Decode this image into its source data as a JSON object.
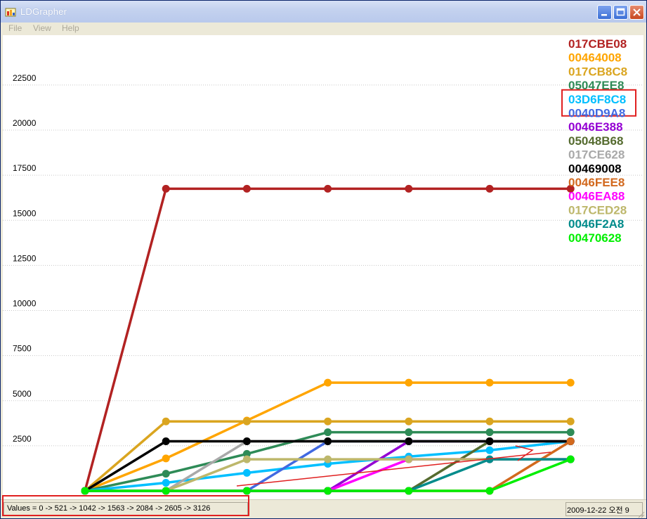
{
  "window": {
    "title": "LDGrapher",
    "minimize_icon": "minimize-icon",
    "maximize_icon": "maximize-icon",
    "close_icon": "close-icon"
  },
  "menu": {
    "items": [
      "File",
      "View",
      "Help"
    ]
  },
  "status": {
    "values_text": "Values = 0 -> 521 -> 1042 -> 1563 -> 2084 -> 2605 -> 3126",
    "date_text": "2009-12-22 오전 9"
  },
  "colors": {
    "highlight": "#e02020",
    "grid": "#c8c8c8"
  },
  "chart_data": {
    "type": "line",
    "title": "",
    "xlabel": "",
    "ylabel": "",
    "ylim": [
      0,
      25000
    ],
    "yticks": [
      2500,
      5000,
      7500,
      10000,
      12500,
      15000,
      17500,
      20000,
      22500
    ],
    "x": [
      0,
      1,
      2,
      3,
      4,
      5,
      6
    ],
    "grid": true,
    "legend_position": "top-right",
    "highlighted_legend_entry": "03D6F8C8",
    "series": [
      {
        "name": "017CBE08",
        "color": "#b22222",
        "values": [
          0,
          16750,
          16750,
          16750,
          16750,
          16750,
          16750
        ]
      },
      {
        "name": "00464008",
        "color": "#ffa500",
        "values": [
          0,
          1800,
          3900,
          6000,
          6000,
          6000,
          6000
        ]
      },
      {
        "name": "017CB8C8",
        "color": "#daa520",
        "values": [
          0,
          3850,
          3850,
          3850,
          3850,
          3850,
          3850
        ]
      },
      {
        "name": "05047EE8",
        "color": "#2e8b57",
        "values": [
          0,
          950,
          2050,
          3250,
          3250,
          3250,
          3250
        ]
      },
      {
        "name": "03D6F8C8",
        "color": "#00bfff",
        "values": [
          0,
          450,
          1000,
          1500,
          1900,
          2250,
          2750
        ]
      },
      {
        "name": "0040D9A8",
        "color": "#4169e1",
        "values": [
          0,
          0,
          0,
          2750,
          2750,
          2750,
          2750
        ]
      },
      {
        "name": "0046E388",
        "color": "#9400d3",
        "values": [
          0,
          0,
          0,
          0,
          2750,
          2750,
          2750
        ]
      },
      {
        "name": "05048B68",
        "color": "#556b2f",
        "values": [
          0,
          0,
          0,
          0,
          0,
          2750,
          2750
        ]
      },
      {
        "name": "017CE628",
        "color": "#a9a9a9",
        "values": [
          0,
          0,
          2750,
          2750,
          2750,
          2750,
          2750
        ]
      },
      {
        "name": "00469008",
        "color": "#000000",
        "values": [
          0,
          2750,
          2750,
          2750,
          2750,
          2750,
          2750
        ]
      },
      {
        "name": "0046FEE8",
        "color": "#d2691e",
        "values": [
          0,
          0,
          0,
          0,
          0,
          0,
          2750
        ]
      },
      {
        "name": "0046EA88",
        "color": "#ff00ff",
        "values": [
          0,
          0,
          0,
          0,
          1750,
          1750,
          1750
        ]
      },
      {
        "name": "017CED28",
        "color": "#bdb76b",
        "values": [
          0,
          0,
          1750,
          1750,
          1750,
          1750,
          1750
        ]
      },
      {
        "name": "0046F2A8",
        "color": "#008b8b",
        "values": [
          0,
          0,
          0,
          0,
          0,
          1750,
          1750
        ]
      },
      {
        "name": "00470628",
        "color": "#00ee00",
        "values": [
          0,
          0,
          0,
          0,
          0,
          0,
          1750
        ]
      }
    ]
  }
}
